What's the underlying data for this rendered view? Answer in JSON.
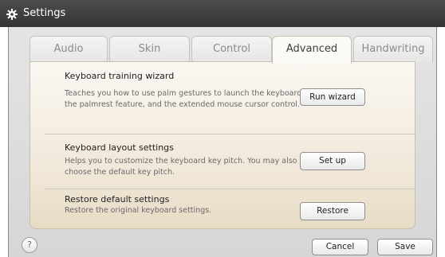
{
  "window": {
    "title": "Settings",
    "icon": "gear-icon"
  },
  "tabs": [
    {
      "label": "Audio"
    },
    {
      "label": "Skin"
    },
    {
      "label": "Control"
    },
    {
      "label": "Advanced",
      "active": true
    },
    {
      "label": "Handwriting"
    }
  ],
  "sections": {
    "training": {
      "heading": "Keyboard training wizard",
      "description_lines": [
        "Teaches you how to use palm gestures to launch the keyboard,",
        "the palmrest feature, and the extended mouse cursor control."
      ],
      "button_label": "Run wizard"
    },
    "layout": {
      "heading": "Keyboard layout settings",
      "description_lines": [
        "Helps you to customize the keyboard key pitch. You may also",
        "choose the default key pitch."
      ],
      "button_label": "Set up"
    },
    "restore": {
      "heading": "Restore default settings",
      "description_lines": [
        "Restore the original keyboard settings."
      ],
      "button_label": "Restore"
    }
  },
  "footer": {
    "help_label": "?",
    "cancel_label": "Cancel",
    "save_label": "Save"
  },
  "colors": {
    "titlebar": "#3e3e3e",
    "panel_top": "#fbf8f3",
    "panel_bottom": "#e7dbc4"
  }
}
